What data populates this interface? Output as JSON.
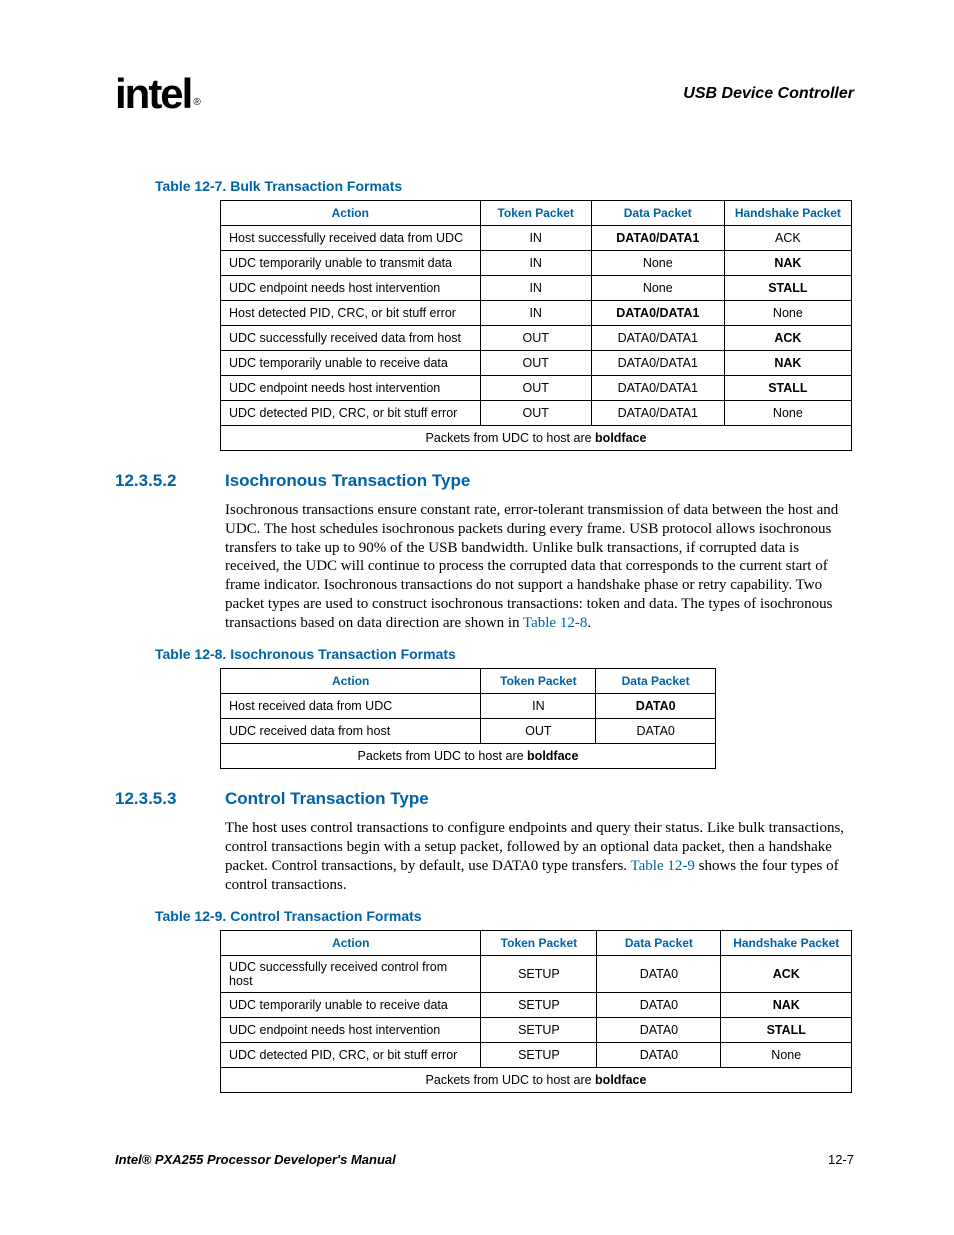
{
  "header": {
    "logo_text": "intel",
    "reg": "®",
    "section_title": "USB Device Controller"
  },
  "table7": {
    "caption": "Table 12-7. Bulk Transaction Formats",
    "headers": [
      "Action",
      "Token Packet",
      "Data Packet",
      "Handshake Packet"
    ],
    "rows": [
      {
        "action": "Host successfully received data from UDC",
        "token": "IN",
        "data": "DATA0/DATA1",
        "data_bold": true,
        "hs": "ACK",
        "hs_bold": false
      },
      {
        "action": "UDC temporarily unable to transmit data",
        "token": "IN",
        "data": "None",
        "data_bold": false,
        "hs": "NAK",
        "hs_bold": true
      },
      {
        "action": "UDC endpoint needs host intervention",
        "token": "IN",
        "data": "None",
        "data_bold": false,
        "hs": "STALL",
        "hs_bold": true
      },
      {
        "action": "Host detected PID, CRC, or bit stuff error",
        "token": "IN",
        "data": "DATA0/DATA1",
        "data_bold": true,
        "hs": "None",
        "hs_bold": false
      },
      {
        "action": "UDC successfully received data from host",
        "token": "OUT",
        "data": "DATA0/DATA1",
        "data_bold": false,
        "hs": "ACK",
        "hs_bold": true
      },
      {
        "action": "UDC temporarily unable to receive data",
        "token": "OUT",
        "data": "DATA0/DATA1",
        "data_bold": false,
        "hs": "NAK",
        "hs_bold": true
      },
      {
        "action": "UDC endpoint needs host intervention",
        "token": "OUT",
        "data": "DATA0/DATA1",
        "data_bold": false,
        "hs": "STALL",
        "hs_bold": true
      },
      {
        "action": "UDC detected PID, CRC, or bit stuff error",
        "token": "OUT",
        "data": "DATA0/DATA1",
        "data_bold": false,
        "hs": "None",
        "hs_bold": false
      }
    ],
    "footer_prefix": "Packets from UDC to host are ",
    "footer_bold": "boldface"
  },
  "sec2": {
    "num": "12.3.5.2",
    "title": "Isochronous Transaction Type",
    "para_pre": "Isochronous transactions ensure constant rate, error-tolerant transmission of data between the host and UDC. The host schedules isochronous packets during every frame. USB protocol allows isochronous transfers to take up to 90% of the USB bandwidth. Unlike bulk transactions, if corrupted data is received, the UDC will continue to process the corrupted data that corresponds to the current start of frame indicator. Isochronous transactions do not support a handshake phase or retry capability. Two packet types are used to construct isochronous transactions: token and data. The types of isochronous transactions based on data direction are shown in ",
    "para_xref": "Table 12-8",
    "para_post": "."
  },
  "table8": {
    "caption": "Table 12-8. Isochronous Transaction Formats",
    "headers": [
      "Action",
      "Token Packet",
      "Data Packet"
    ],
    "rows": [
      {
        "action": "Host received data from UDC",
        "token": "IN",
        "data": "DATA0",
        "data_bold": true
      },
      {
        "action": "UDC received data from host",
        "token": "OUT",
        "data": "DATA0",
        "data_bold": false
      }
    ],
    "footer_prefix": "Packets from UDC to host are ",
    "footer_bold": "boldface"
  },
  "sec3": {
    "num": "12.3.5.3",
    "title": "Control Transaction Type",
    "para_pre": "The host uses control transactions to configure endpoints and query their status. Like bulk transactions, control transactions begin with a setup packet, followed by an optional data packet, then a handshake packet. Control transactions, by default, use DATA0 type transfers. ",
    "para_xref": "Table 12-9",
    "para_post": " shows the four types of control transactions."
  },
  "table9": {
    "caption": "Table 12-9. Control Transaction Formats",
    "headers": [
      "Action",
      "Token Packet",
      "Data Packet",
      "Handshake Packet"
    ],
    "rows": [
      {
        "action": "UDC successfully received control from host",
        "token": "SETUP",
        "data": "DATA0",
        "hs": "ACK",
        "hs_bold": true
      },
      {
        "action": "UDC temporarily unable to receive data",
        "token": "SETUP",
        "data": "DATA0",
        "hs": "NAK",
        "hs_bold": true
      },
      {
        "action": "UDC endpoint needs host intervention",
        "token": "SETUP",
        "data": "DATA0",
        "hs": "STALL",
        "hs_bold": true
      },
      {
        "action": "UDC detected PID, CRC, or bit stuff error",
        "token": "SETUP",
        "data": "DATA0",
        "hs": "None",
        "hs_bold": false
      }
    ],
    "footer_prefix": "Packets from UDC to host are ",
    "footer_bold": "boldface"
  },
  "footer": {
    "left": "Intel® PXA255 Processor Developer's Manual",
    "right": "12-7"
  }
}
